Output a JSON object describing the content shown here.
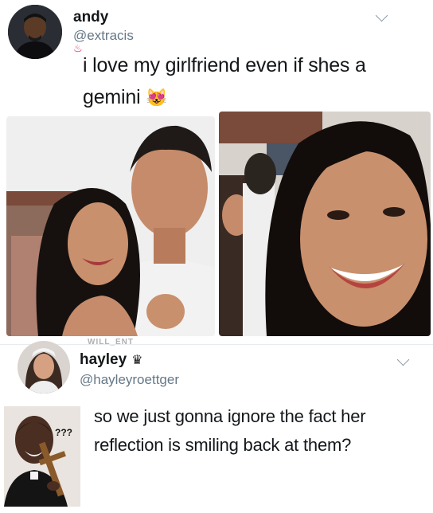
{
  "tweet": {
    "author_name": "andy",
    "author_handle": "@extracis",
    "text_line1": "i love my girlfriend even if shes a",
    "text_line2": "gemini",
    "emoji": "😻"
  },
  "photo_watermark": "WILL_ENT",
  "reply": {
    "author_name": "hayley",
    "author_handle": "@hayleyroettger",
    "text_line1": "so we just gonna ignore the fact her",
    "text_line2": "reflection is smiling back at them?",
    "meme_caption": "???"
  },
  "colors": {
    "handle": "#657786",
    "text": "#14171a",
    "divider": "#e6ecf0"
  },
  "icons": [
    "chevron-down-icon",
    "crown-icon",
    "emoji-heart-eyes-cat-icon"
  ]
}
